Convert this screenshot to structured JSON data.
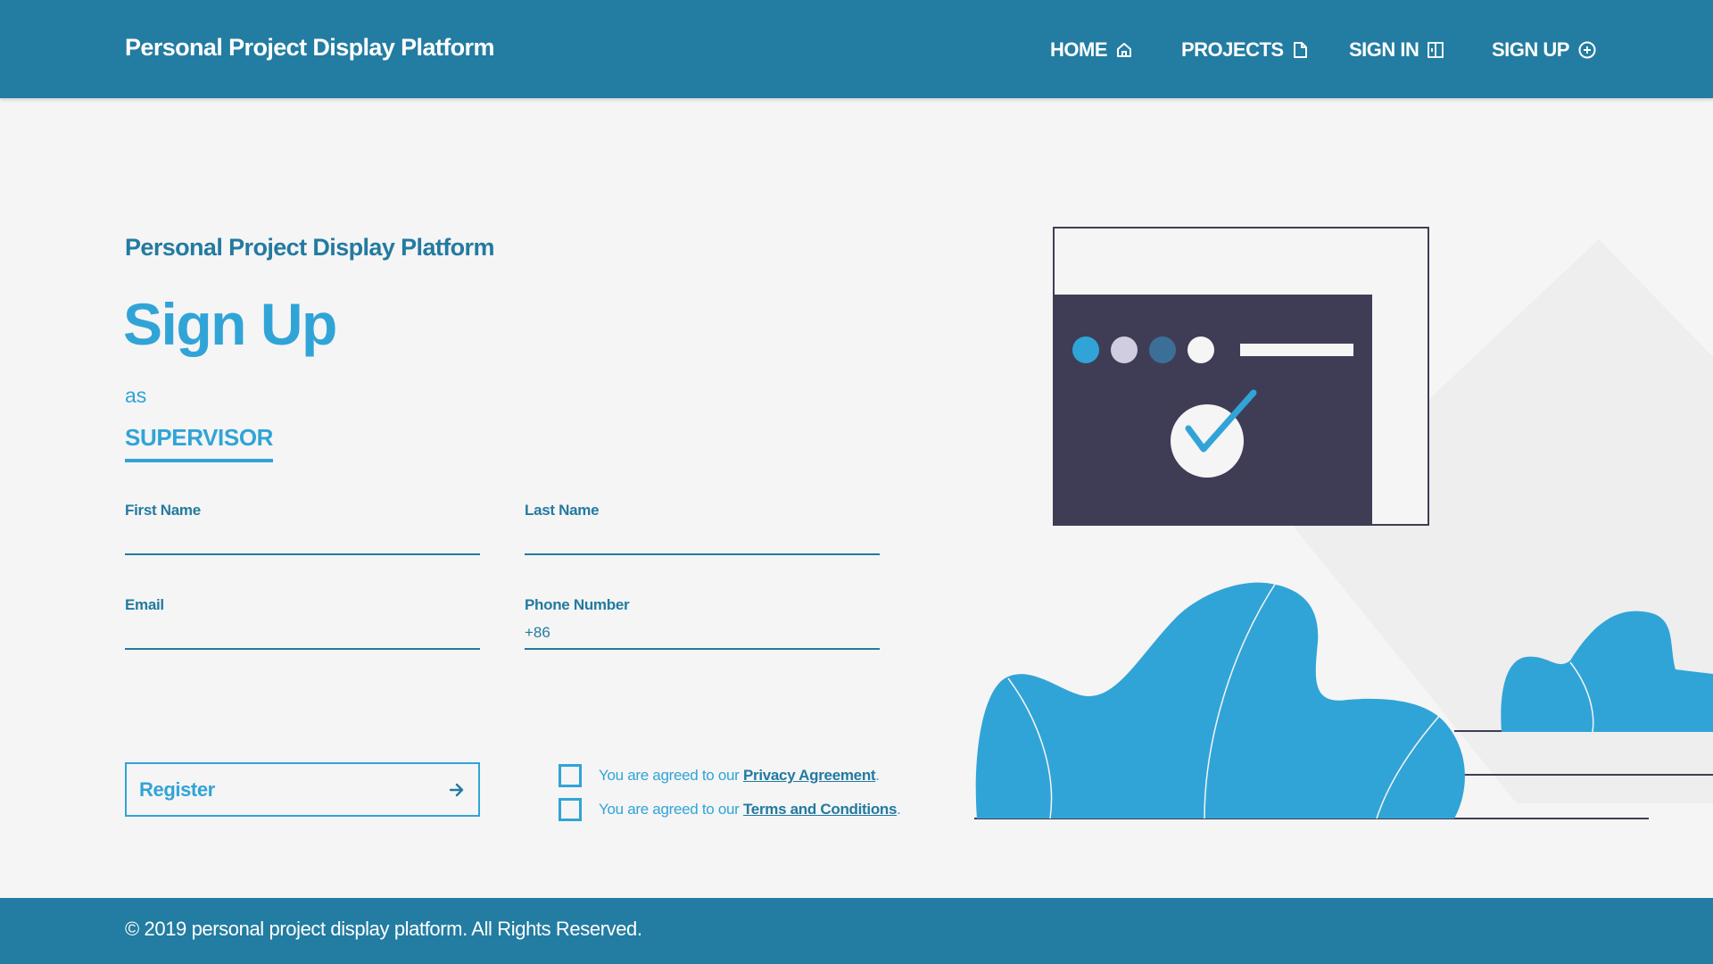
{
  "navbar": {
    "brand": "Personal Project Display Platform",
    "items": [
      {
        "label": "HOME",
        "icon": "home-icon"
      },
      {
        "label": "PROJECTS",
        "icon": "file-icon"
      },
      {
        "label": "SIGN IN",
        "icon": "sign-in-icon"
      },
      {
        "label": "SIGN UP",
        "icon": "plus-circle-icon"
      }
    ]
  },
  "main": {
    "subtitle": "Personal Project Display Platform",
    "title": "Sign Up",
    "as_text": "as",
    "role": "SUPERVISOR",
    "fields": {
      "first_name": {
        "label": "First Name",
        "value": "",
        "placeholder": ""
      },
      "last_name": {
        "label": "Last Name",
        "value": "",
        "placeholder": ""
      },
      "email": {
        "label": "Email",
        "value": "",
        "placeholder": ""
      },
      "phone": {
        "label": "Phone Number",
        "value": "",
        "placeholder": "+86"
      }
    },
    "register_label": "Register",
    "agreements": [
      {
        "prefix": "You are agreed to our ",
        "link": "Privacy Agreement",
        "suffix": ".",
        "checked": false
      },
      {
        "prefix": "You are agreed to our ",
        "link": "Terms and Conditions",
        "suffix": ".",
        "checked": false
      }
    ]
  },
  "footer": {
    "text": "© 2019 personal project display platform. All Rights Reserved."
  },
  "colors": {
    "primary": "#237ca1",
    "accent": "#31a4d7",
    "background": "#f5f5f5",
    "illustration_dark": "#3f3d56"
  }
}
